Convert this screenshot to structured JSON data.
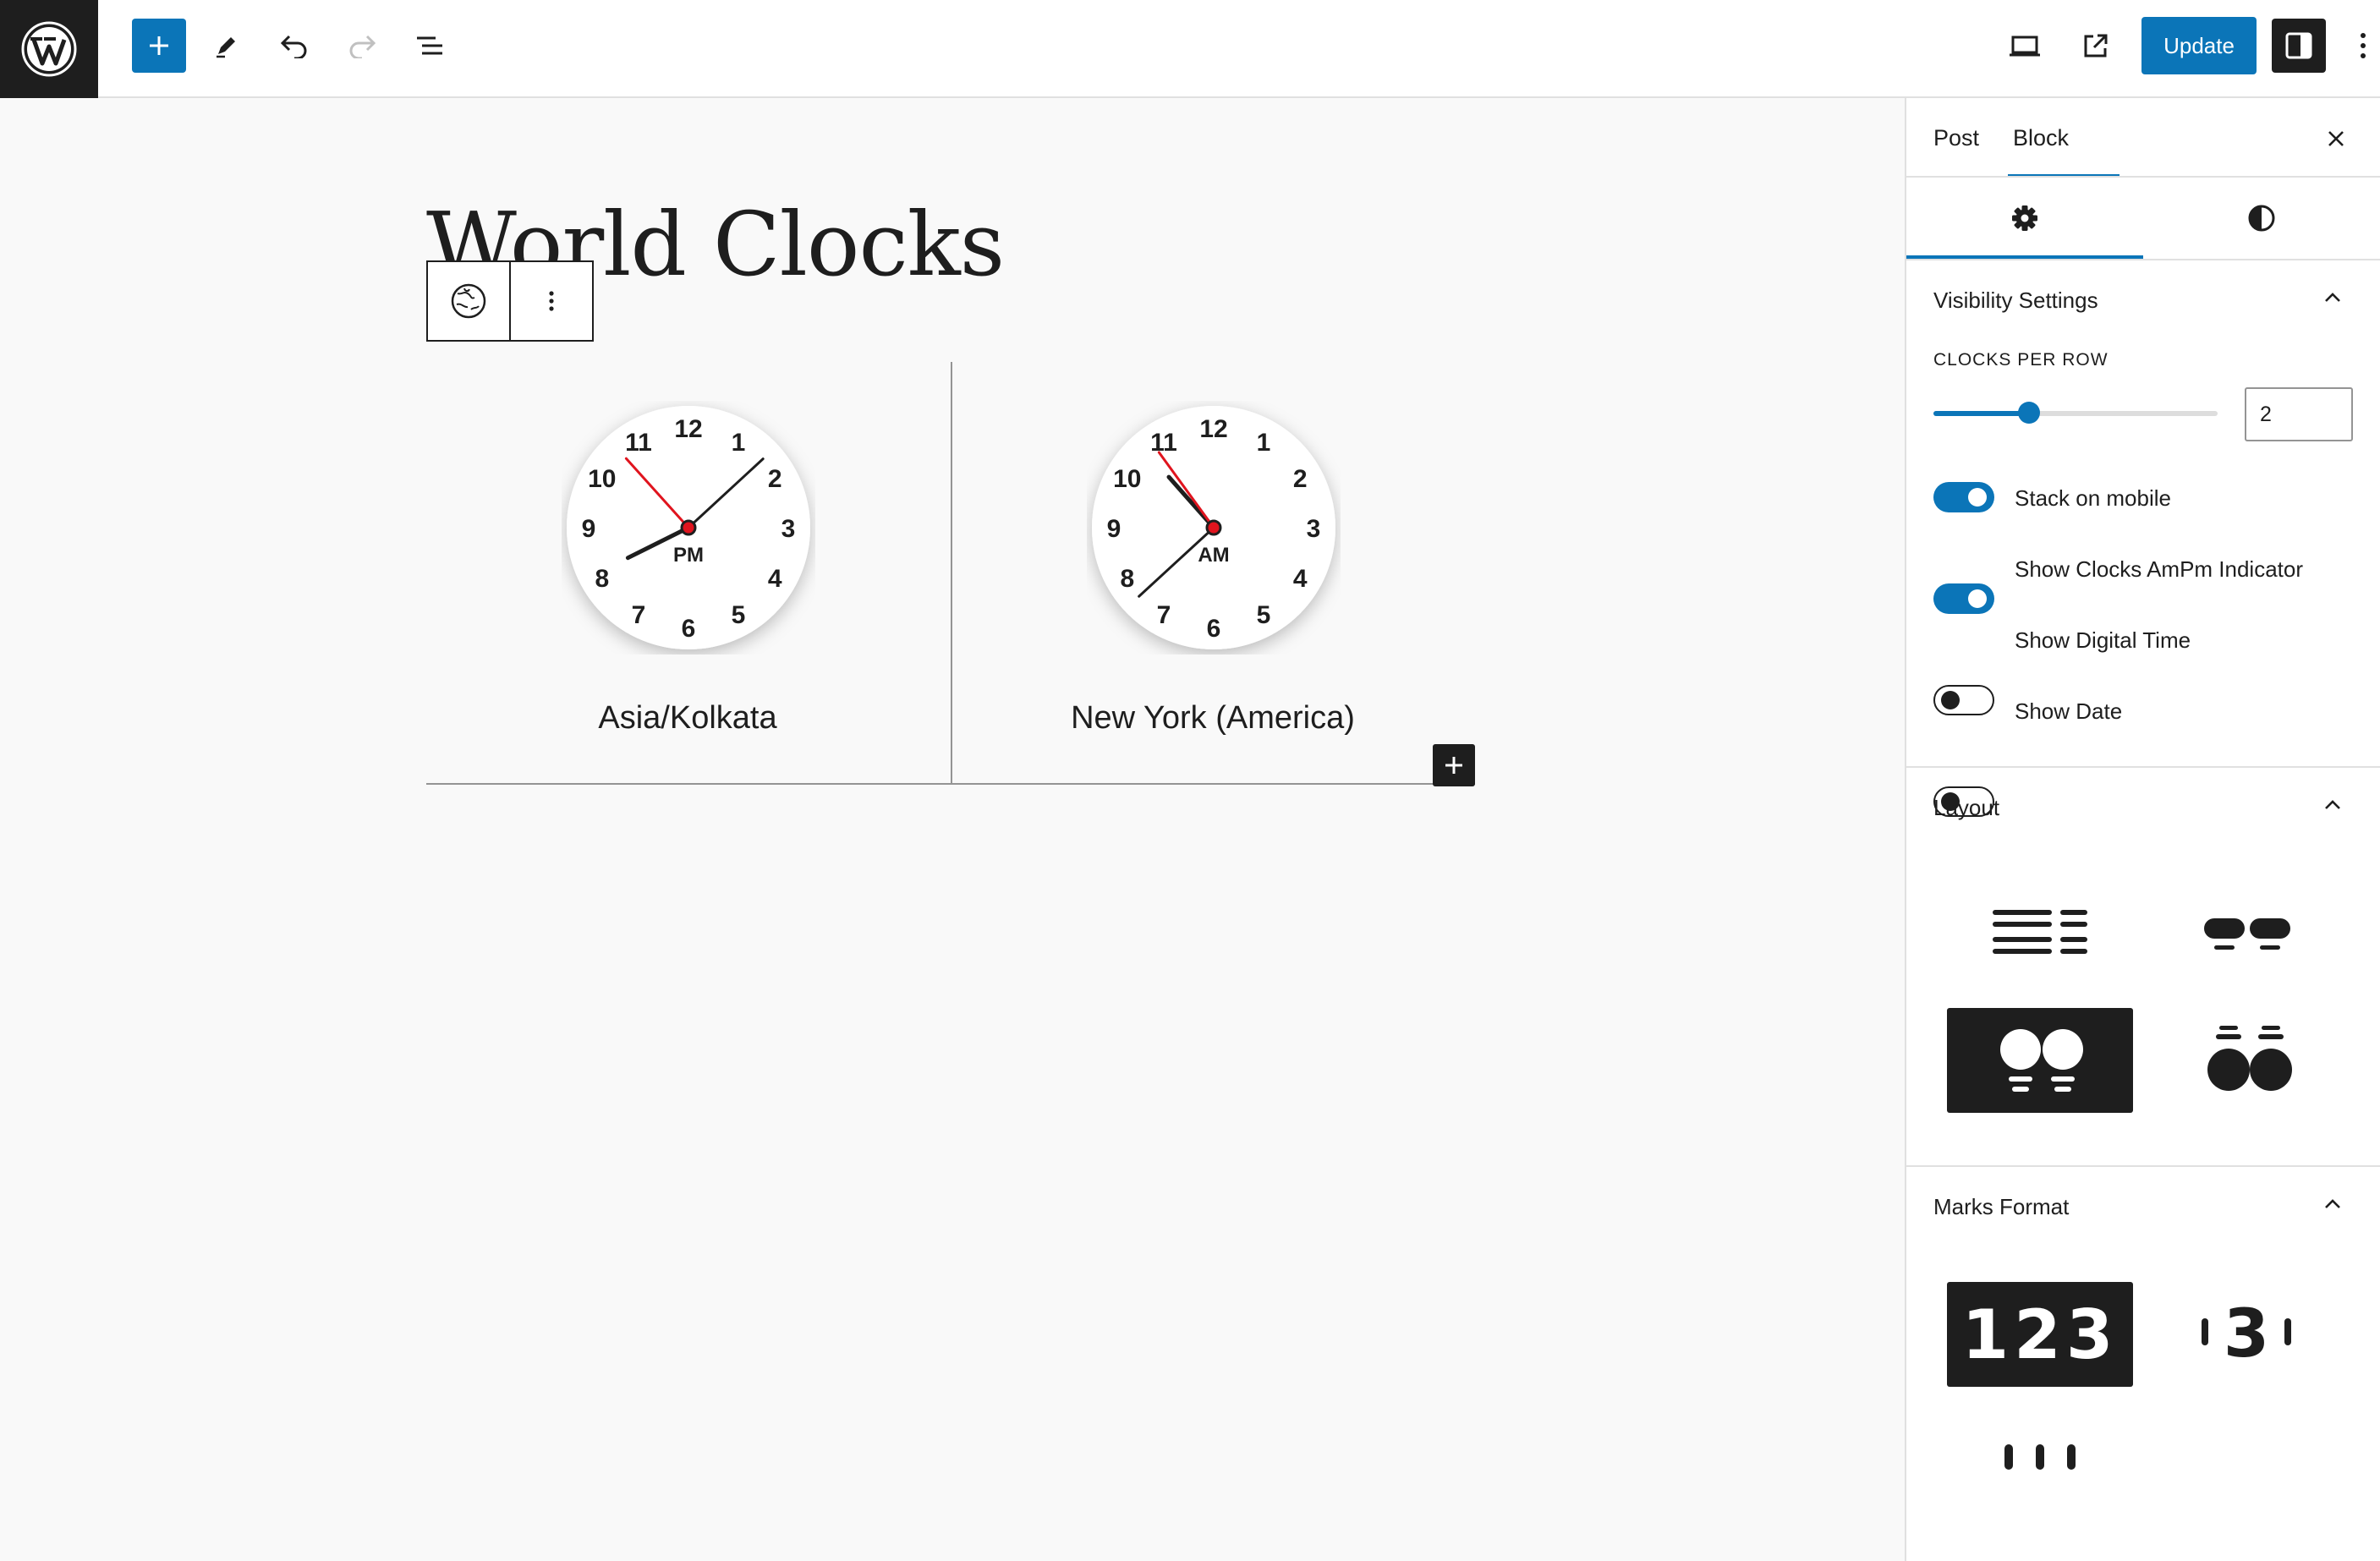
{
  "header": {
    "update_label": "Update"
  },
  "post": {
    "title": "World Clocks"
  },
  "clocks": [
    {
      "label": "Asia/Kolkata",
      "ampm": "PM",
      "hour": 8,
      "minute": 7,
      "second": 53
    },
    {
      "label": "New York (America)",
      "ampm": "AM",
      "hour": 10,
      "minute": 37,
      "second": 54
    }
  ],
  "clock_face_numbers": [
    "12",
    "1",
    "2",
    "3",
    "4",
    "5",
    "6",
    "7",
    "8",
    "9",
    "10",
    "11"
  ],
  "sidebar": {
    "tabs": [
      {
        "label": "Post"
      },
      {
        "label": "Block",
        "active": true
      }
    ],
    "visibility": {
      "title": "Visibility Settings",
      "clocks_per_row_label": "CLOCKS PER ROW",
      "clocks_per_row_value": "2",
      "toggles": [
        {
          "label": "Stack on mobile",
          "on": true
        },
        {
          "label": "Show Clocks AmPm Indicator",
          "on": true
        },
        {
          "label": "Show Digital Time",
          "on": false
        },
        {
          "label": "Show Date",
          "on": false
        }
      ]
    },
    "layout": {
      "title": "Layout",
      "selected_option": 3
    },
    "marks_format": {
      "title": "Marks Format",
      "option_numbers": "123",
      "option_mixed": "3",
      "selected_option": 1
    }
  },
  "colors": {
    "accent": "#0b75b8",
    "dark": "#1e1e1e",
    "second_hand": "#e0141e"
  }
}
